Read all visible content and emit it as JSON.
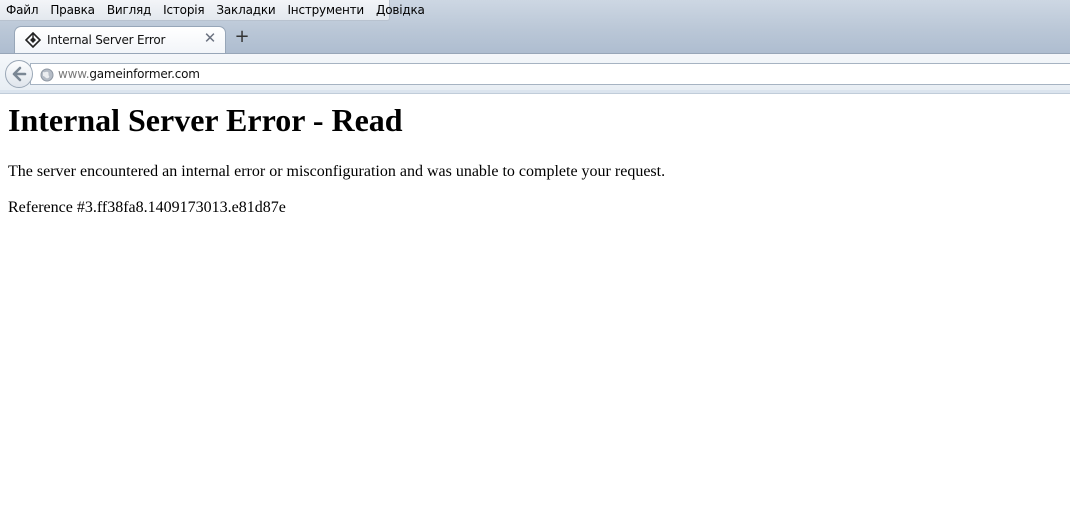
{
  "menubar": {
    "items": [
      "Файл",
      "Правка",
      "Вигляд",
      "Історія",
      "Закладки",
      "Інструменти",
      "Довідка"
    ]
  },
  "tab": {
    "title": "Internal Server Error",
    "icon": "site-favicon-icon",
    "close_glyph": "✕"
  },
  "new_tab": {
    "glyph": "+"
  },
  "navbar": {
    "back_icon": "back-arrow-icon",
    "site_icon": "globe-icon",
    "url_prefix": "www.",
    "url_host": "gameinformer.com"
  },
  "page": {
    "heading": "Internal Server Error - Read",
    "message": "The server encountered an internal error or misconfiguration and was unable to complete your request.",
    "reference": "Reference #3.ff38fa8.1409173013.e81d87e"
  },
  "colors": {
    "chrome_top": "#b9c6d6",
    "navbar": "#eef2f6",
    "border": "#97a6b8"
  }
}
